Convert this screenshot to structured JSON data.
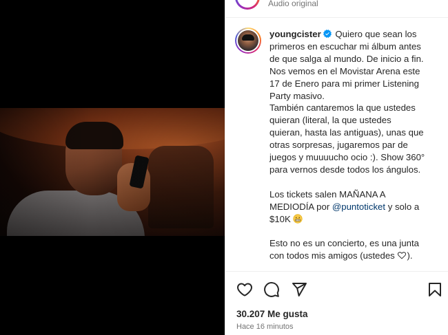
{
  "header": {
    "audio_label": "Audio original"
  },
  "post": {
    "username": "youngcister",
    "verified": true,
    "caption_lines": [
      "Quiero que sean los",
      "primeros en escuchar mi álbum antes",
      "de que salga al mundo. De inicio a fin.",
      "Nos vemos en el Movistar Arena este",
      "17 de Enero para mi primer Listening",
      "Party masivo.",
      "También cantaremos la que ustedes",
      "quieran (literal, la que ustedes",
      "quieran, hasta las antiguas), unas que",
      "otras sorpresas, jugaremos par de",
      "juegos y muuuucho ocio :). Show 360°",
      "para vernos desde todos los ángulos."
    ],
    "tickets_line1": "Los tickets salen MAÑANA A",
    "tickets_line2_before": "MEDIODÍA por ",
    "mention": "@puntoticket",
    "tickets_line2_after": " y solo a",
    "tickets_line3": "$10K ",
    "closing_line1": "Esto no es un concierto, es una junta",
    "closing_line2": "con todos mis amigos (ustedes ",
    "closing_line2_end": ")."
  },
  "actions": {
    "like_icon": "heart-icon",
    "comment_icon": "comment-icon",
    "share_icon": "send-icon",
    "save_icon": "bookmark-icon"
  },
  "stats": {
    "likes": "30.207 Me gusta",
    "time_ago": "Hace 16 minutos"
  },
  "colors": {
    "text": "#262626",
    "secondary": "#737373",
    "link": "#00376b",
    "verified": "#0095f6",
    "divider": "#efefef"
  }
}
